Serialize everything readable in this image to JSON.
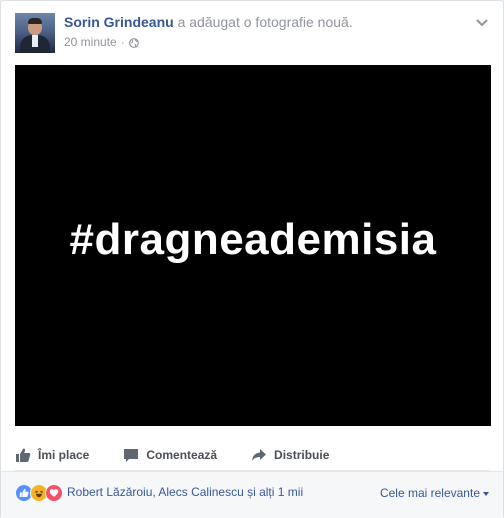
{
  "post": {
    "author": "Sorin Grindeanu",
    "action_text": " a adăugat o fotografie nouă.",
    "time": "20 minute",
    "separator": "·",
    "privacy_icon": "globe-icon",
    "menu_icon": "chevron-down-icon"
  },
  "photo": {
    "text": "#dragneademisia",
    "background": "#000000"
  },
  "actions": {
    "like_label": "Îmi place",
    "comment_label": "Comentează",
    "share_label": "Distribuie"
  },
  "reactions": {
    "types": [
      "like-reaction-icon",
      "haha-reaction-icon",
      "love-reaction-icon"
    ],
    "summary": "Robert Lăzăroiu, Alecs Calinescu și alți 1 mii",
    "sort_label": "Cele mai relevante"
  },
  "colors": {
    "link": "#365899",
    "meta": "#90949c",
    "action_text": "#4b4f56",
    "like": "#5890ff",
    "haha": "#f7b125",
    "love": "#f25268"
  }
}
